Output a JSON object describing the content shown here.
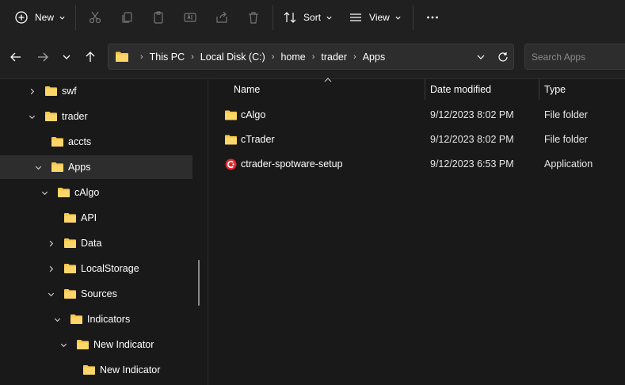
{
  "toolbar": {
    "new_label": "New",
    "sort_label": "Sort",
    "view_label": "View",
    "icons": [
      "plus-circle-icon",
      "cut-icon",
      "copy-icon",
      "paste-icon",
      "rename-icon",
      "share-icon",
      "delete-icon",
      "sort-icon",
      "view-icon",
      "more-icon"
    ]
  },
  "address": {
    "crumbs": [
      "This PC",
      "Local Disk (C:)",
      "home",
      "trader",
      "Apps"
    ]
  },
  "search": {
    "placeholder": "Search Apps"
  },
  "sidebar": {
    "items": [
      {
        "label": "swf",
        "expand": "collapsed"
      },
      {
        "label": "trader",
        "expand": "expanded"
      },
      {
        "label": "accts",
        "expand": "none"
      },
      {
        "label": "Apps",
        "expand": "expanded",
        "selected": true
      },
      {
        "label": "cAlgo",
        "expand": "expanded"
      },
      {
        "label": "API",
        "expand": "none"
      },
      {
        "label": "Data",
        "expand": "collapsed"
      },
      {
        "label": "LocalStorage",
        "expand": "collapsed"
      },
      {
        "label": "Sources",
        "expand": "expanded"
      },
      {
        "label": "Indicators",
        "expand": "expanded"
      },
      {
        "label": "New Indicator",
        "expand": "expanded"
      },
      {
        "label": "New Indicator",
        "expand": "none"
      }
    ]
  },
  "columns": {
    "name": "Name",
    "date": "Date modified",
    "type": "Type"
  },
  "files": [
    {
      "name": "cAlgo",
      "date": "9/12/2023 8:02 PM",
      "type": "File folder",
      "icon": "folder-icon"
    },
    {
      "name": "cTrader",
      "date": "9/12/2023 8:02 PM",
      "type": "File folder",
      "icon": "folder-icon"
    },
    {
      "name": "ctrader-spotware-setup",
      "date": "9/12/2023 6:53 PM",
      "type": "Application",
      "icon": "ctrader-app-icon"
    }
  ],
  "colors": {
    "folder": "#f8c94c",
    "app_red": "#e0262b",
    "background": "#191919",
    "toolbar": "#202020"
  }
}
